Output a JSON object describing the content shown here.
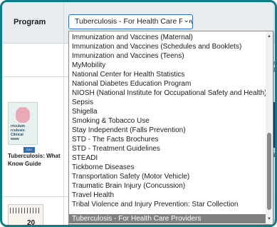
{
  "filter": {
    "label": "Program",
    "selected_value": "Tuberculosis - For Health Care Provic",
    "chevron_icon": "chevron-down-icon"
  },
  "dropdown": {
    "options": [
      "Immunization and Vaccines (Maternal)",
      "Immunization and Vaccines (Schedules and Booklets)",
      "Immunization and Vaccines (Teens)",
      "MyMobility",
      "National Center for Health Statistics",
      "National Diabetes Education Program",
      "NIOSH (National Institute for Occupational Safety and Health)",
      "Sepsis",
      "Shigella",
      "Smoking & Tobacco Use",
      "Stay Independent (Falls Prevention)",
      "STD - The Facts Brochures",
      "STD - Treatment Guidelines",
      "STEADI",
      "Tickborne Diseases",
      "Transportation Safety (Motor Vehicle)",
      "Traumatic Brain Injury (Concussion)",
      "Travel Health",
      "Tribal Violence and Injury Prevention: Star Collection",
      "Tuberculosis - For Health Care Providers"
    ],
    "selected_index": 19,
    "scroll_up_icon": "triangle-up-icon",
    "scroll_down_icon": "triangle-down-icon"
  },
  "background": {
    "card_left": {
      "thumbnail_text": "rriculum\nrculosis:\nClinical\nwww",
      "title": "Tuberculosis: What\nKnow Guide"
    },
    "right_edge_letter": "r P",
    "right_card_snippet": "in",
    "ruler_number": "20"
  },
  "colors": {
    "frame_border": "#0e7c86",
    "select_border": "#2d6cdf",
    "selected_option_bg": "#808080"
  }
}
